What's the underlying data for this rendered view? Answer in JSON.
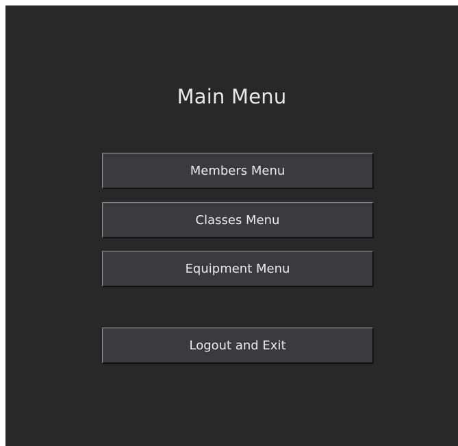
{
  "window": {
    "title": "Main Menu"
  },
  "menu": {
    "members_label": "Members Menu",
    "classes_label": "Classes Menu",
    "equipment_label": "Equipment Menu",
    "logout_label": "Logout and Exit"
  },
  "colors": {
    "background": "#282828",
    "button_face": "#3b3a3c",
    "text": "#ececec"
  }
}
